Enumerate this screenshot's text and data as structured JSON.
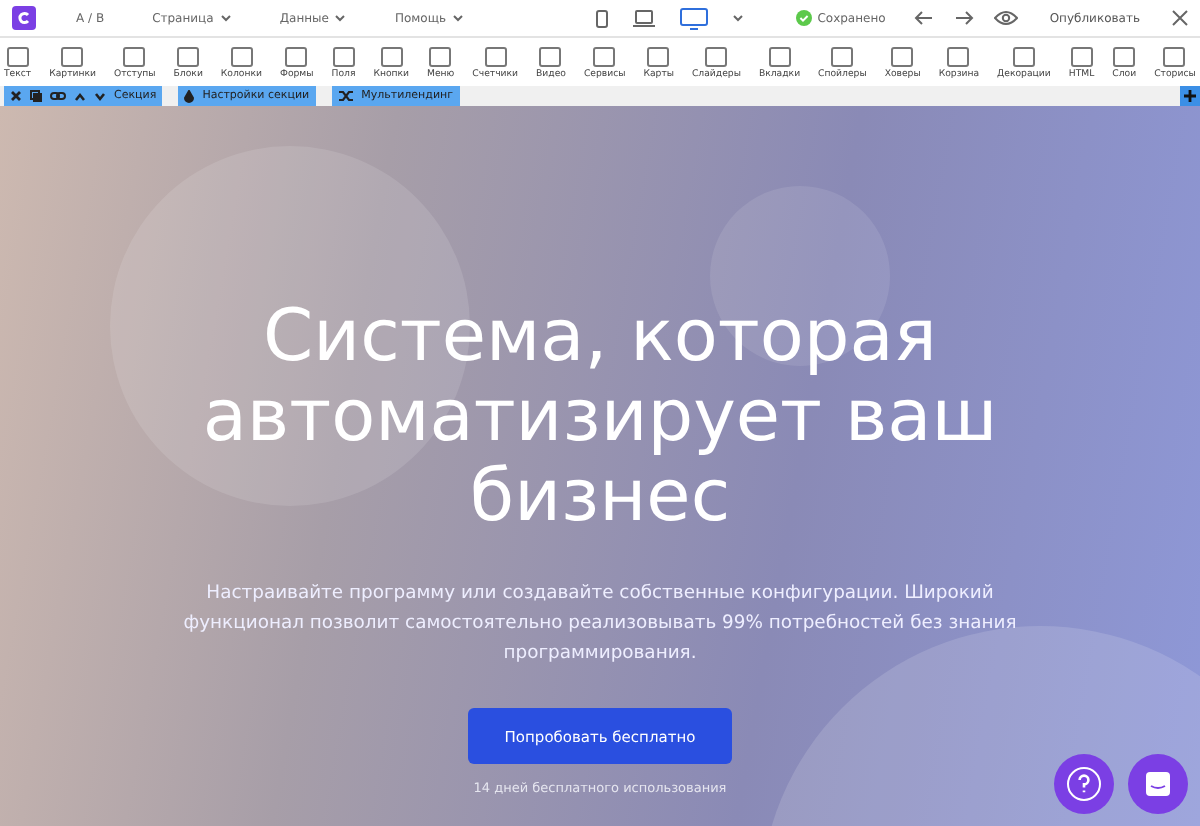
{
  "topbar": {
    "ab": "A / B",
    "menus": [
      "Страница",
      "Данные",
      "Помощь"
    ],
    "devices": [
      {
        "kind": "phone",
        "selected": false
      },
      {
        "kind": "laptop",
        "selected": false
      },
      {
        "kind": "monitor",
        "selected": true
      }
    ],
    "status": "Сохранено",
    "publish": "Опубликовать"
  },
  "tools": [
    "Текст",
    "Картинки",
    "Отступы",
    "Блоки",
    "Колонки",
    "Формы",
    "Поля",
    "Кнопки",
    "Меню",
    "Счетчики",
    "Видео",
    "Сервисы",
    "Карты",
    "Слайдеры",
    "Вкладки",
    "Спойлеры",
    "Ховеры",
    "Корзина",
    "Декорации",
    "HTML",
    "Слои",
    "Сторисы"
  ],
  "section_bar": {
    "section": "Секция",
    "settings": "Настройки секции",
    "multilanding": "Мультилендинг"
  },
  "hero": {
    "title": "Система, которая автоматизирует ваш бизнес",
    "text": "Настраивайте программу или создавайте собственные конфигурации. Широкий функционал позволит самостоятельно реализовывать 99% потребностей без знания программирования.",
    "button": "Попробовать бесплатно",
    "note": "14 дней бесплатного использования"
  }
}
